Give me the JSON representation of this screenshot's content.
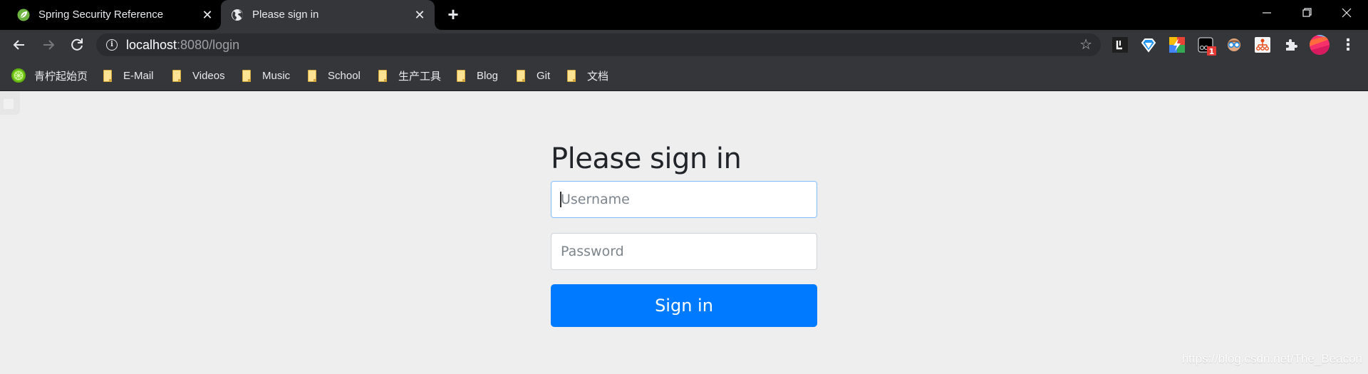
{
  "browser": {
    "tabs": [
      {
        "title": "Spring Security Reference",
        "icon": "spring-leaf-icon",
        "active": false,
        "close": "✕"
      },
      {
        "title": "Please sign in",
        "icon": "globe-icon",
        "active": true,
        "close": "✕"
      }
    ],
    "new_tab": "+",
    "window_controls": {
      "minimize": "—",
      "restore": "❐",
      "close": "✕"
    },
    "nav": {
      "back": "←",
      "forward": "→",
      "reload": "↻"
    },
    "address": {
      "host": "localhost",
      "rest": ":8080/login",
      "info_icon": "i",
      "star": "☆"
    },
    "extensions": [
      {
        "name": "l-extension-icon"
      },
      {
        "name": "diamond-extension-icon"
      },
      {
        "name": "lightning-extension-icon"
      },
      {
        "name": "screen-extension-icon",
        "badge": "1"
      },
      {
        "name": "face-glasses-extension-icon"
      },
      {
        "name": "org-chart-extension-icon"
      },
      {
        "name": "puzzle-extensions-icon"
      },
      {
        "name": "profile-avatar"
      },
      {
        "name": "menu-dots-icon",
        "glyph": "⋮"
      }
    ],
    "bookmarks": [
      {
        "label": "青柠起始页",
        "icon": "lime-icon"
      },
      {
        "label": "E-Mail",
        "icon": "folder-icon"
      },
      {
        "label": "Videos",
        "icon": "folder-icon"
      },
      {
        "label": "Music",
        "icon": "folder-icon"
      },
      {
        "label": "School",
        "icon": "folder-icon"
      },
      {
        "label": "生产工具",
        "icon": "folder-icon"
      },
      {
        "label": "Blog",
        "icon": "folder-icon"
      },
      {
        "label": "Git",
        "icon": "folder-icon"
      },
      {
        "label": "文档",
        "icon": "folder-icon"
      }
    ]
  },
  "page": {
    "heading": "Please sign in",
    "username": {
      "placeholder": "Username",
      "value": ""
    },
    "password": {
      "placeholder": "Password",
      "value": ""
    },
    "submit_label": "Sign in",
    "watermark": "https://blog.csdn.net/The_Beacon"
  },
  "colors": {
    "primary": "#007bff",
    "focus_border": "#80bdff",
    "page_bg": "#eeeeee"
  }
}
